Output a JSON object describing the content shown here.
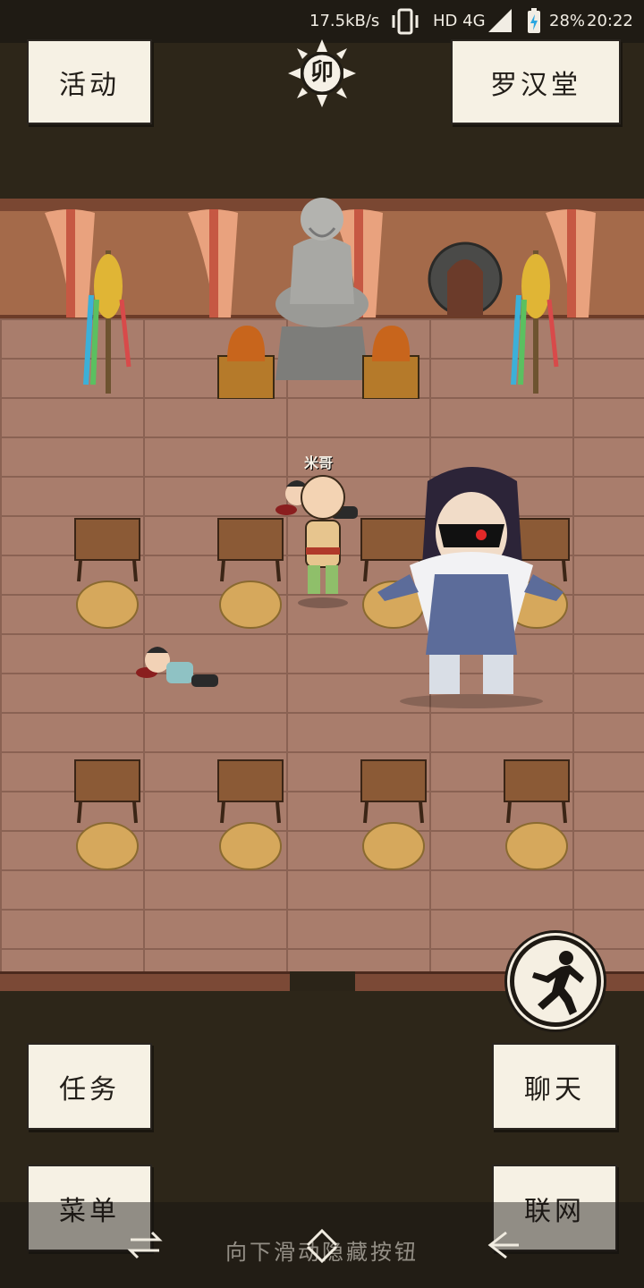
{
  "status_bar": {
    "net_speed": "17.5kB/s",
    "network": "HD 4G",
    "battery": "28%",
    "time": "20:22"
  },
  "top": {
    "activity_label": "活动",
    "time_badge": "卯",
    "location_label": "罗汉堂"
  },
  "scene": {
    "player_name": "米哥"
  },
  "bottom": {
    "tasks_label": "任务",
    "chat_label": "聊天",
    "menu_label": "菜单",
    "network_label": "联网"
  },
  "navbar": {
    "hint": "向下滑动隐藏按钮"
  },
  "colors": {
    "paper": "#f6f1e4",
    "wall": "#a46a4a",
    "floor": "#a97d6c",
    "dark_band": "#2d2619"
  }
}
